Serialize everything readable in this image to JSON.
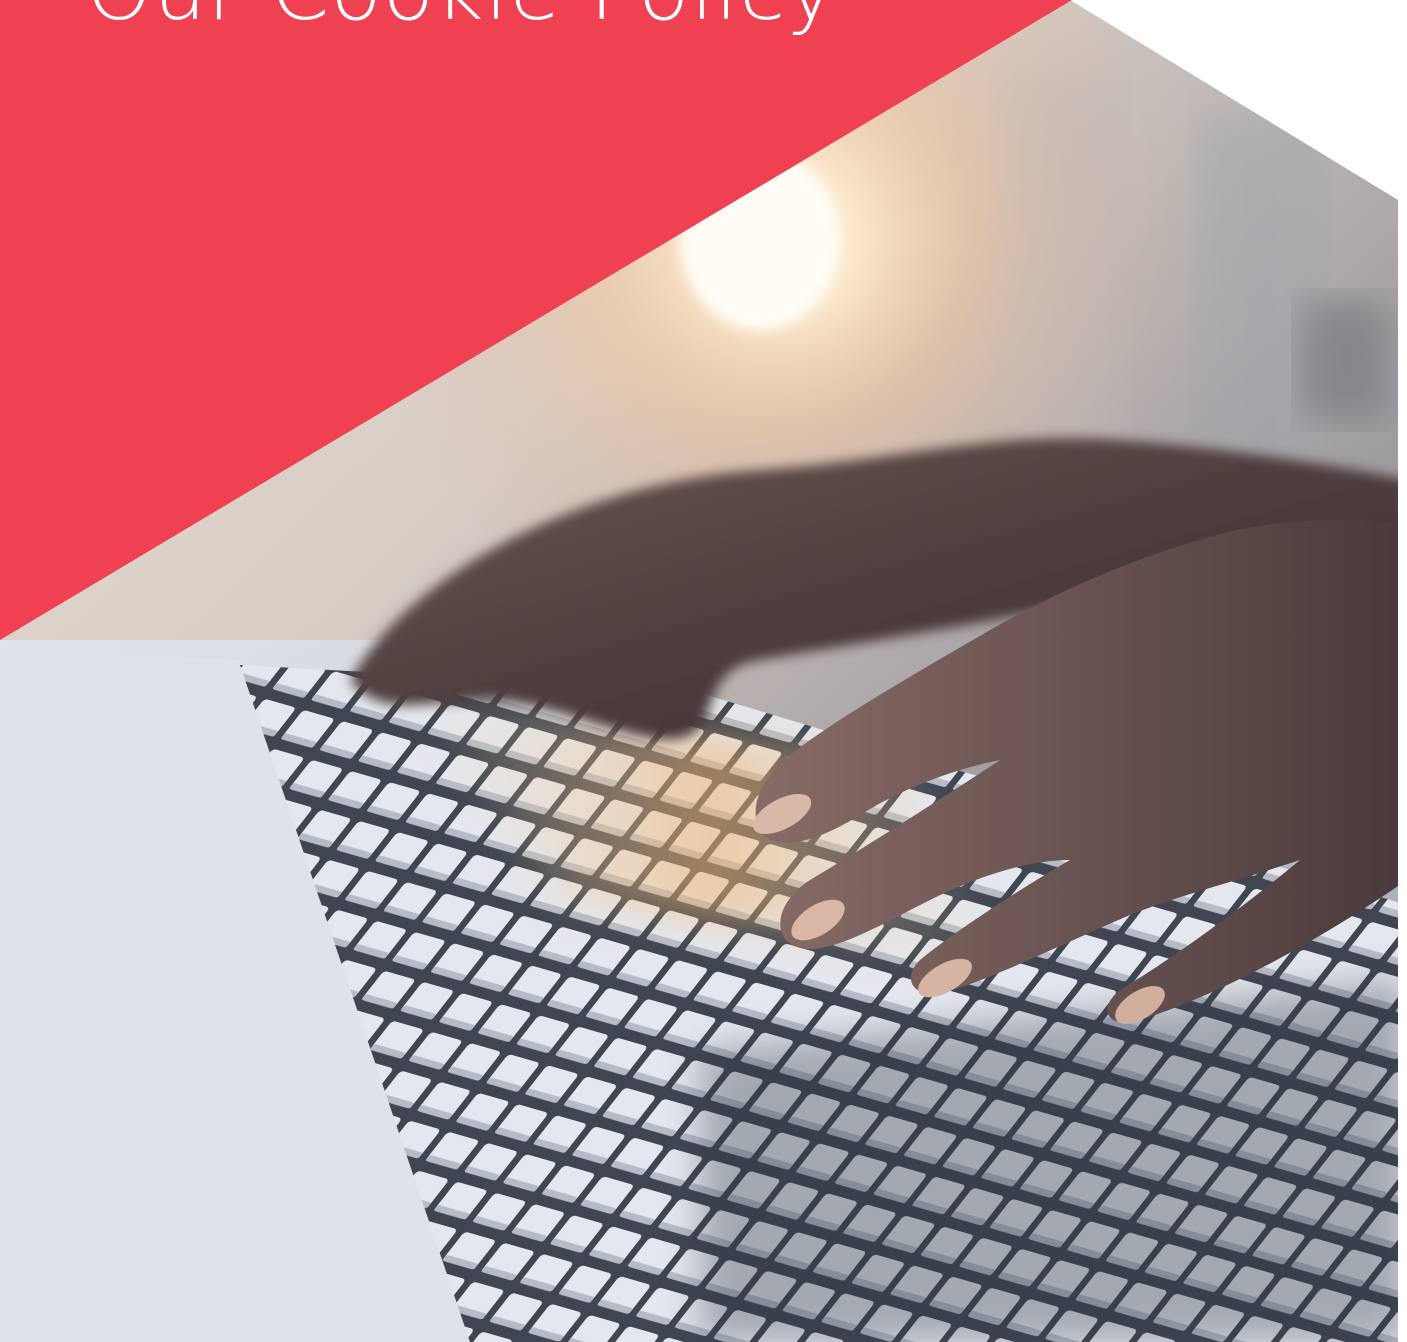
{
  "document": {
    "title": "Our Cookie Policy"
  },
  "colors": {
    "accent_red": "#ef4152",
    "background": "#ffffff",
    "title_text": "#ffffff"
  },
  "cover_image": {
    "subject": "hands typing on a laptop keyboard at sunset",
    "icon": "photo-icon"
  }
}
